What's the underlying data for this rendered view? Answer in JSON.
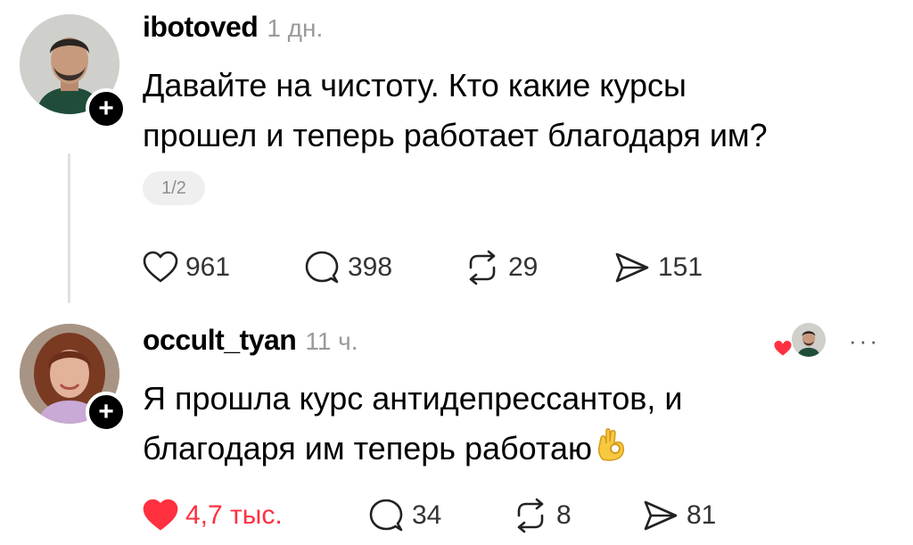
{
  "posts": [
    {
      "username": "ibotoved",
      "time": "1 дн.",
      "text_line1": "Давайте на чистоту. Кто какие курсы",
      "text_line2": "прошел и теперь работает благодаря им?",
      "media_counter": "1/2",
      "likes": "961",
      "comments": "398",
      "reposts": "29",
      "shares": "151",
      "liked": false
    },
    {
      "username": "occult_tyan",
      "time": "11 ч.",
      "text_line1": "Я прошла курс антидепрессантов, и",
      "text_line2": "благодаря им теперь работаю",
      "likes": "4,7 тыс.",
      "comments": "34",
      "reposts": "8",
      "shares": "81",
      "liked": true,
      "more_label": "···"
    }
  ],
  "icons": {
    "like": "heart-icon",
    "comment": "comment-bubble-icon",
    "repost": "repost-icon",
    "share": "share-icon",
    "follow": "plus-icon",
    "emoji": "ok-hand-emoji"
  },
  "colors": {
    "like_active": "#ff3040",
    "muted_text": "#9a9a9a"
  }
}
